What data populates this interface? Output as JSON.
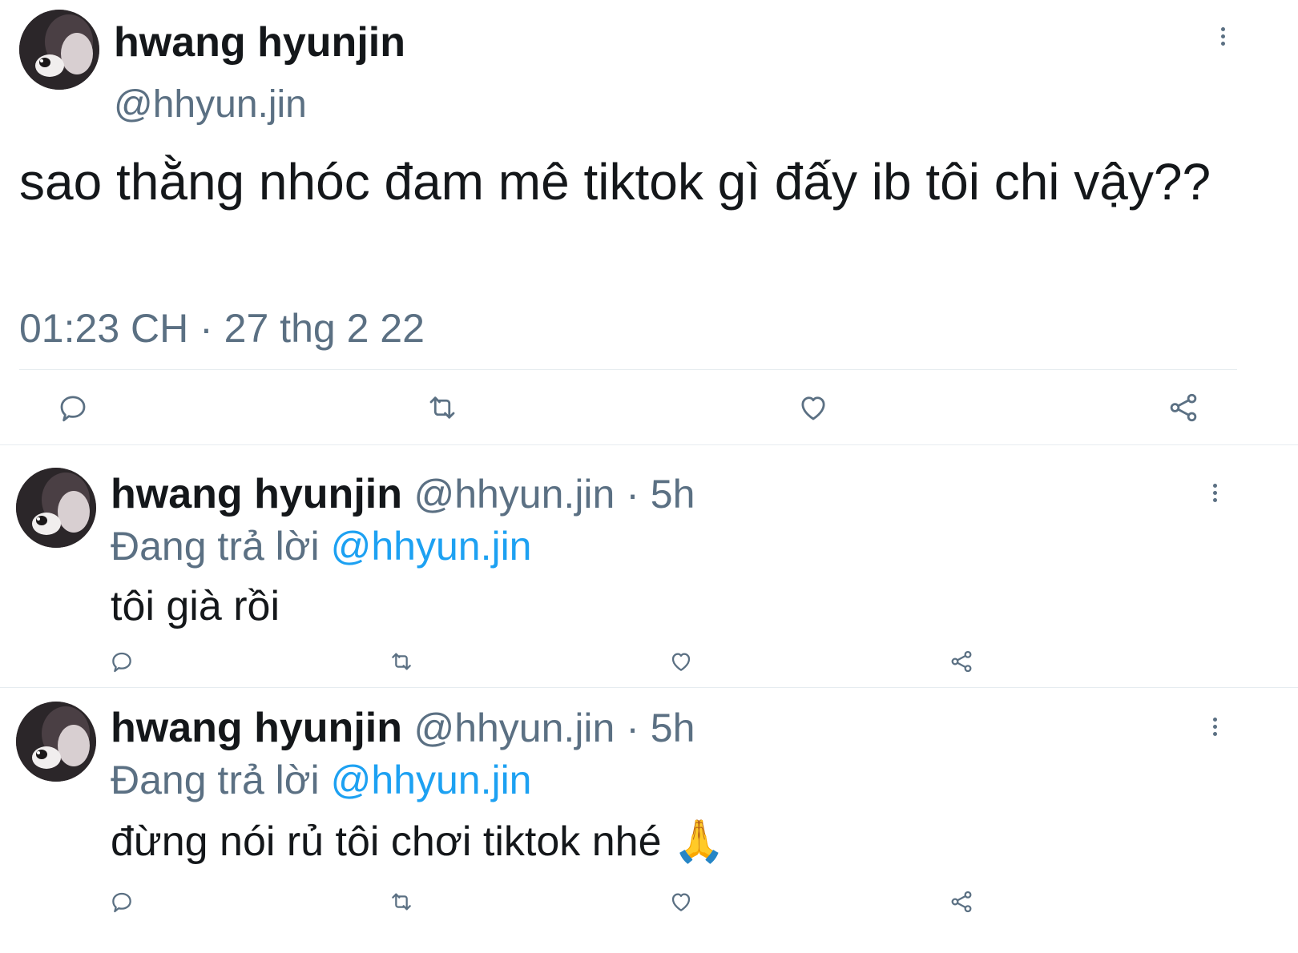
{
  "main_tweet": {
    "author_name": "hwang hyunjin",
    "handle": "@hhyun.jin",
    "text": "sao thằng nhóc đam mê tiktok gì đấy ib tôi chi vậy??",
    "timestamp": "01:23 CH · 27 thg 2 22",
    "icons": [
      "reply-icon",
      "retweet-icon",
      "like-icon",
      "share-icon",
      "more-icon"
    ]
  },
  "replies": [
    {
      "author_name": "hwang hyunjin",
      "meta": "@hhyun.jin · 5h",
      "replying_prefix": "Đang trả lời",
      "replying_handle": "@hhyun.jin",
      "text": "tôi già rồi"
    },
    {
      "author_name": "hwang hyunjin",
      "meta": "@hhyun.jin · 5h",
      "replying_prefix": "Đang trả lời",
      "replying_handle": "@hhyun.jin",
      "text": "đừng nói rủ tôi chơi tiktok nhé 🙏"
    }
  ],
  "colors": {
    "text": "#14171a",
    "muted": "#5b7083",
    "link": "#1da1f2",
    "divider": "#e6ecf0"
  }
}
